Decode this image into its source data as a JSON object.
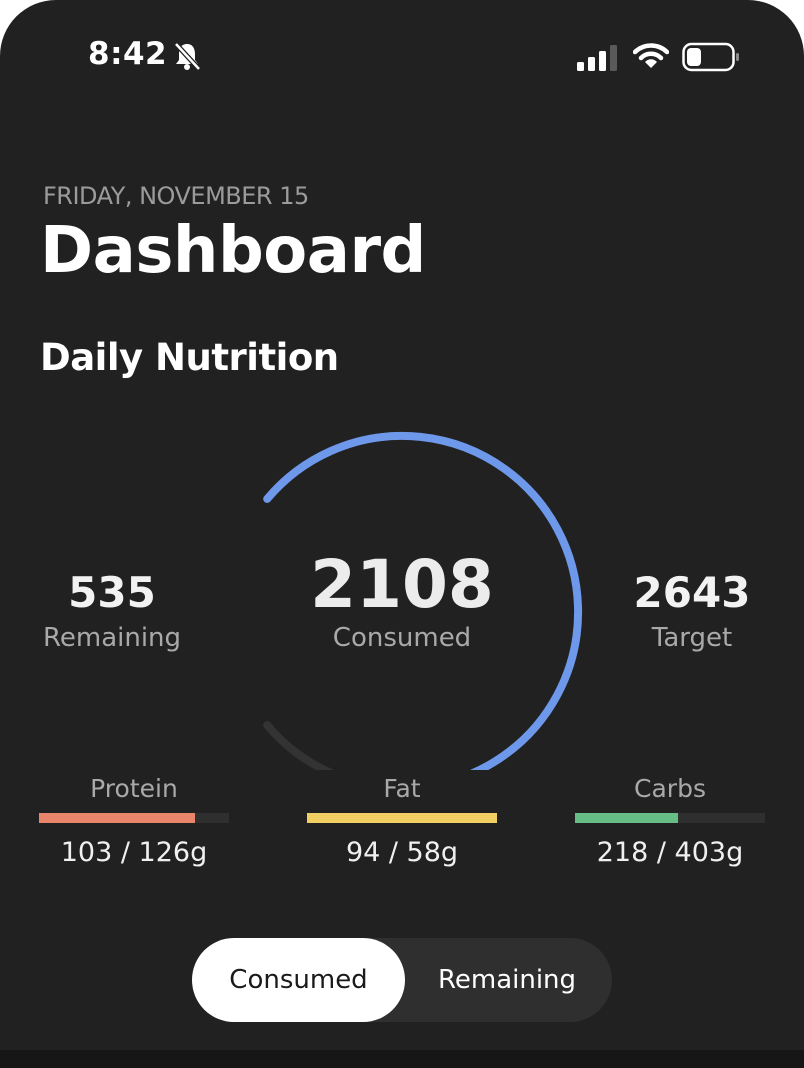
{
  "status_bar": {
    "time": "8:42"
  },
  "header": {
    "date": "FRIDAY, NOVEMBER 15",
    "title": "Dashboard"
  },
  "nutrition": {
    "section_title": "Daily Nutrition",
    "remaining": {
      "value": "535",
      "label": "Remaining"
    },
    "consumed": {
      "value": "2108",
      "label": "Consumed"
    },
    "target": {
      "value": "2643",
      "label": "Target"
    },
    "progress_fraction": 0.8,
    "colors": {
      "ring": "#6e98ea",
      "ring_track": "#333333"
    }
  },
  "macros": {
    "protein": {
      "label": "Protein",
      "value": "103 / 126g",
      "fraction": 0.82,
      "color": "#e8856a"
    },
    "fat": {
      "label": "Fat",
      "value": "94 / 58g",
      "fraction": 1.0,
      "color": "#f2cf63"
    },
    "carbs": {
      "label": "Carbs",
      "value": "218 / 403g",
      "fraction": 0.54,
      "color": "#66bd86"
    }
  },
  "toggle": {
    "options": [
      "Consumed",
      "Remaining"
    ],
    "selected": "Consumed"
  }
}
